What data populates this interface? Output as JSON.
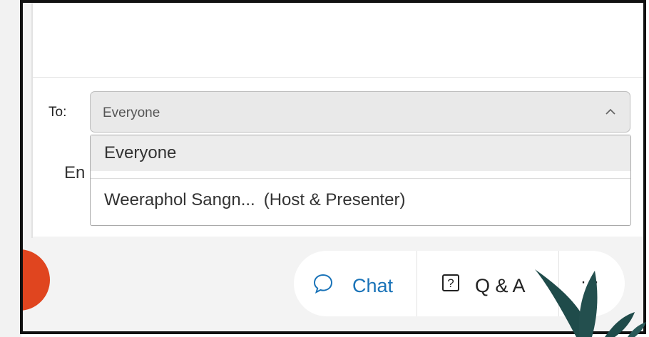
{
  "to_row": {
    "label": "To:",
    "selected_value": "Everyone"
  },
  "behind_text": "En",
  "dropdown": {
    "options": [
      {
        "label": "Everyone",
        "highlighted": true
      },
      {
        "label": "Weeraphol Sangn...",
        "role": "(Host & Presenter)"
      }
    ]
  },
  "toolbar": {
    "chat_label": "Chat",
    "qa_icon_text": "?",
    "qa_label": "Q & A",
    "more_label": "···"
  },
  "icons": {
    "chevron": "chevron-up-icon",
    "chat": "chat-bubble-icon",
    "qa": "question-box-icon",
    "more": "ellipsis-icon",
    "decor": "leaf-decoration"
  },
  "colors": {
    "accent_blue": "#1a73b8",
    "orange": "#e0451f",
    "leaf": "#1f4b4a",
    "frame": "#111111"
  }
}
